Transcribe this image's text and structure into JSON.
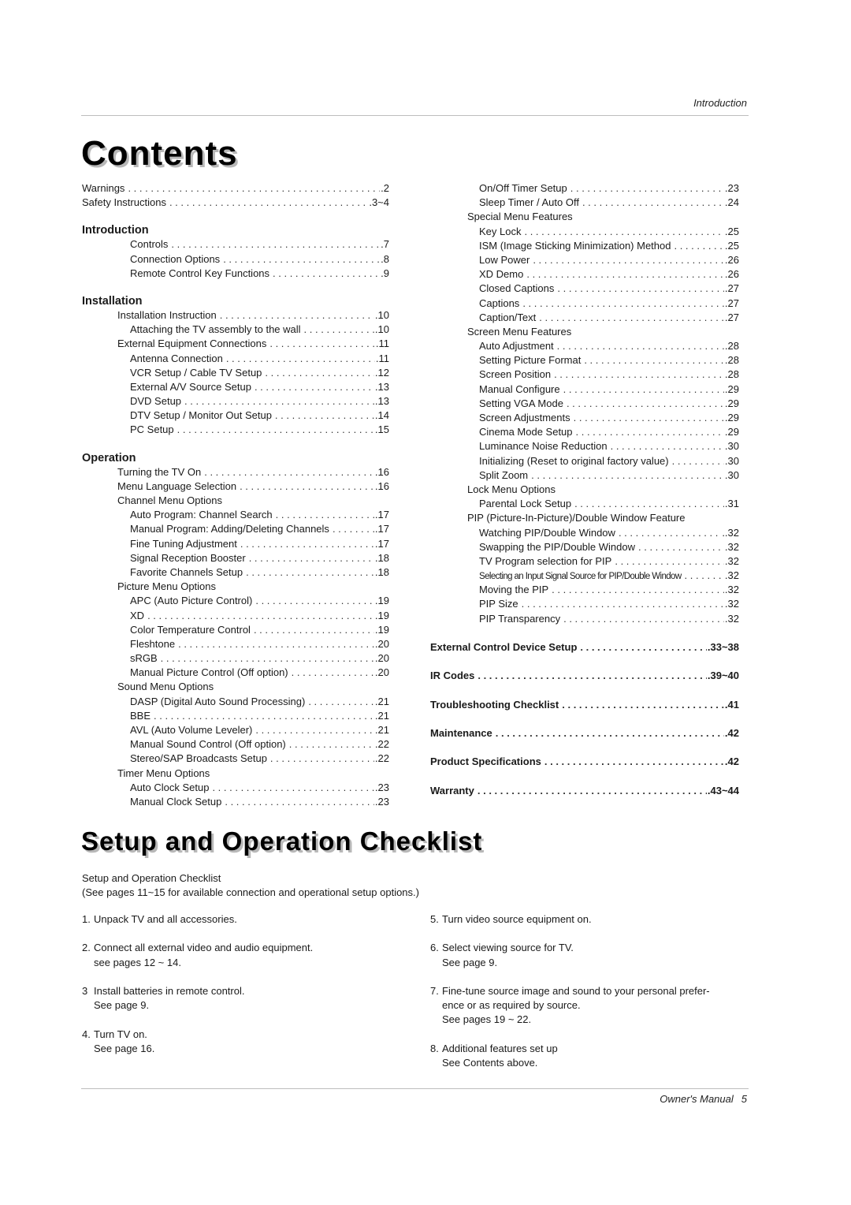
{
  "header": {
    "section": "Introduction"
  },
  "footer": {
    "label": "Owner's Manual",
    "page": "5"
  },
  "contents": {
    "title": "Contents",
    "left": {
      "top": [
        {
          "label": "Warnings",
          "page": ".2"
        },
        {
          "label": "Safety Instructions",
          "page": ".3~4"
        }
      ],
      "sections": [
        {
          "heading": "Introduction",
          "entries": [
            {
              "label": "Controls",
              "page": ".7",
              "level": 2
            },
            {
              "label": "Connection Options",
              "page": ".8",
              "level": 2
            },
            {
              "label": "Remote Control Key Functions",
              "page": ".9",
              "level": 2
            }
          ]
        },
        {
          "heading": "Installation",
          "entries": [
            {
              "label": "Installation Instruction",
              "page": ".10",
              "level": 1
            },
            {
              "label": "Attaching the TV assembly to the wall",
              "page": ".10",
              "level": 2
            },
            {
              "label": "External Equipment Connections",
              "page": ".11",
              "level": 1
            },
            {
              "label": "Antenna Connection",
              "page": ".11",
              "level": 2
            },
            {
              "label": "VCR Setup / Cable TV Setup",
              "page": ".12",
              "level": 2
            },
            {
              "label": "External A/V Source Setup",
              "page": ".13",
              "level": 2
            },
            {
              "label": "DVD Setup",
              "page": ".13",
              "level": 2
            },
            {
              "label": "DTV Setup / Monitor Out Setup",
              "page": ".14",
              "level": 2
            },
            {
              "label": "PC Setup",
              "page": ".15",
              "level": 2
            }
          ]
        },
        {
          "heading": "Operation",
          "entries": [
            {
              "label": "Turning the TV On",
              "page": ".16",
              "level": 1
            },
            {
              "label": "Menu Language Selection",
              "page": ".16",
              "level": 1
            },
            {
              "label": "Channel Menu Options",
              "page": "",
              "level": 1
            },
            {
              "label": "Auto Program: Channel Search",
              "page": ".17",
              "level": 2
            },
            {
              "label": "Manual Program: Adding/Deleting Channels",
              "page": ".17",
              "level": 2
            },
            {
              "label": "Fine Tuning Adjustment",
              "page": ".17",
              "level": 2
            },
            {
              "label": "Signal Reception Booster",
              "page": ".18",
              "level": 2
            },
            {
              "label": "Favorite Channels Setup",
              "page": ".18",
              "level": 2
            },
            {
              "label": "Picture Menu Options",
              "page": "",
              "level": 1
            },
            {
              "label": "APC (Auto Picture Control)",
              "page": ".19",
              "level": 2
            },
            {
              "label": "XD",
              "page": ".19",
              "level": 2
            },
            {
              "label": "Color Temperature Control",
              "page": ".19",
              "level": 2
            },
            {
              "label": "Fleshtone",
              "page": ".20",
              "level": 2
            },
            {
              "label": "sRGB",
              "page": ".20",
              "level": 2
            },
            {
              "label": "Manual Picture Control (Off option)",
              "page": ".20",
              "level": 2
            },
            {
              "label": "Sound Menu Options",
              "page": "",
              "level": 1
            },
            {
              "label": "DASP (Digital Auto Sound Processing)",
              "page": ".21",
              "level": 2
            },
            {
              "label": "BBE",
              "page": ".21",
              "level": 2
            },
            {
              "label": "AVL (Auto Volume Leveler)",
              "page": ".21",
              "level": 2
            },
            {
              "label": "Manual Sound Control (Off option)",
              "page": ".22",
              "level": 2
            },
            {
              "label": "Stereo/SAP Broadcasts Setup",
              "page": ".22",
              "level": 2
            },
            {
              "label": "Timer Menu Options",
              "page": "",
              "level": 1
            },
            {
              "label": "Auto Clock Setup",
              "page": ".23",
              "level": 2
            },
            {
              "label": "Manual Clock Setup",
              "page": ".23",
              "level": 2
            }
          ]
        }
      ]
    },
    "right": {
      "entries": [
        {
          "label": "On/Off Timer Setup",
          "page": ".23",
          "level": 2
        },
        {
          "label": "Sleep Timer / Auto Off",
          "page": ".24",
          "level": 2
        },
        {
          "label": "Special Menu Features",
          "page": "",
          "level": 1
        },
        {
          "label": "Key Lock",
          "page": ".25",
          "level": 2
        },
        {
          "label": "ISM (Image Sticking Minimization) Method",
          "page": ".25",
          "level": 2
        },
        {
          "label": "Low Power",
          "page": ".26",
          "level": 2
        },
        {
          "label": "XD Demo",
          "page": ".26",
          "level": 2
        },
        {
          "label": "Closed Captions",
          "page": ".27",
          "level": 2
        },
        {
          "label": "Captions",
          "page": ".27",
          "level": 2
        },
        {
          "label": "Caption/Text",
          "page": ".27",
          "level": 2
        },
        {
          "label": "Screen Menu Features",
          "page": "",
          "level": 1
        },
        {
          "label": "Auto Adjustment",
          "page": ".28",
          "level": 2
        },
        {
          "label": "Setting Picture Format",
          "page": ".28",
          "level": 2
        },
        {
          "label": "Screen Position",
          "page": ".28",
          "level": 2
        },
        {
          "label": "Manual Configure",
          "page": ".29",
          "level": 2
        },
        {
          "label": "Setting VGA Mode",
          "page": ".29",
          "level": 2
        },
        {
          "label": "Screen Adjustments",
          "page": ".29",
          "level": 2
        },
        {
          "label": "Cinema Mode Setup",
          "page": ".29",
          "level": 2
        },
        {
          "label": "Luminance Noise Reduction",
          "page": ".30",
          "level": 2
        },
        {
          "label": "Initializing (Reset to original factory value)",
          "page": ".30",
          "level": 2
        },
        {
          "label": "Split Zoom",
          "page": ".30",
          "level": 2
        },
        {
          "label": "Lock Menu Options",
          "page": "",
          "level": 1
        },
        {
          "label": "Parental Lock Setup",
          "page": ".31",
          "level": 2
        },
        {
          "label": "PIP (Picture-In-Picture)/Double Window Feature",
          "page": "",
          "level": 1
        },
        {
          "label": "Watching PIP/Double Window",
          "page": "..32",
          "level": 2
        },
        {
          "label": "Swapping the PIP/Double Window",
          "page": ".32",
          "level": 2
        },
        {
          "label": "TV Program selection for PIP",
          "page": ".32",
          "level": 2
        },
        {
          "label": "Selecting an Input Signal Source for PIP/Double Window",
          "page": ".32",
          "level": 2,
          "condensed": true
        },
        {
          "label": "Moving the PIP",
          "page": ".32",
          "level": 2
        },
        {
          "label": "PIP Size",
          "page": ".32",
          "level": 2
        },
        {
          "label": "PIP Transparency",
          "page": ".32",
          "level": 2
        }
      ],
      "major": [
        {
          "label": "External Control Device Setup",
          "page": ".33~38"
        },
        {
          "label": "IR Codes",
          "page": ".39~40"
        },
        {
          "label": "Troubleshooting Checklist",
          "page": ".41"
        },
        {
          "label": "Maintenance",
          "page": ".42"
        },
        {
          "label": "Product Specifications",
          "page": ".42"
        },
        {
          "label": "Warranty",
          "page": ".43~44"
        }
      ]
    }
  },
  "checklist": {
    "title": "Setup and Operation Checklist",
    "intro": [
      "Setup and Operation Checklist",
      "(See pages 11~15 for available connection and operational setup options.)"
    ],
    "left": [
      {
        "num": "1.",
        "lines": [
          "Unpack TV and all accessories."
        ]
      },
      {
        "num": "2.",
        "lines": [
          "Connect all external video and audio equipment.",
          "see pages 12 ~ 14."
        ]
      },
      {
        "num": "3",
        "lines": [
          "Install batteries in remote control.",
          "See page 9."
        ]
      },
      {
        "num": "4.",
        "lines": [
          "Turn TV on.",
          "See page 16."
        ]
      }
    ],
    "right": [
      {
        "num": "5.",
        "lines": [
          "Turn video source equipment on."
        ]
      },
      {
        "num": "6.",
        "lines": [
          "Select viewing source for TV.",
          "See page 9."
        ]
      },
      {
        "num": "7.",
        "lines": [
          "Fine-tune source image and sound to your personal prefer-",
          "ence or as required by source.",
          "See pages 19 ~ 22."
        ]
      },
      {
        "num": "8.",
        "lines": [
          "Additional features set up",
          "See Contents above."
        ]
      }
    ]
  }
}
